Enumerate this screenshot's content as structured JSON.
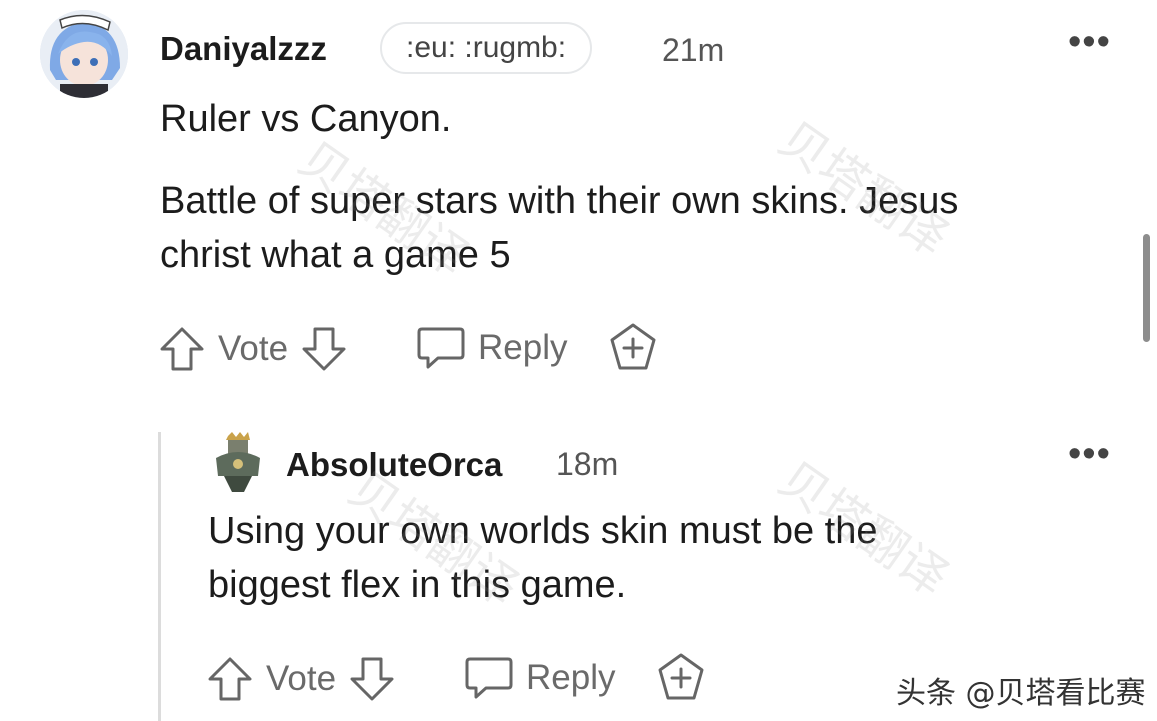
{
  "comments": [
    {
      "username": "Daniyalzzz",
      "flair": ":eu: :rugmb:",
      "time": "21m",
      "paragraphs": [
        "Ruler vs Canyon.",
        "Battle of super stars with their own skins. Jesus",
        "christ what a game 5"
      ],
      "actions": {
        "vote": "Vote",
        "reply": "Reply"
      }
    },
    {
      "username": "AbsoluteOrca",
      "time": "18m",
      "paragraphs": [
        "Using your own worlds skin must be the",
        "biggest flex in this game."
      ],
      "actions": {
        "vote": "Vote",
        "reply": "Reply"
      }
    }
  ],
  "more_label": "•••",
  "watermark": "贝塔翻译",
  "footer": "头条 @贝塔看比赛"
}
